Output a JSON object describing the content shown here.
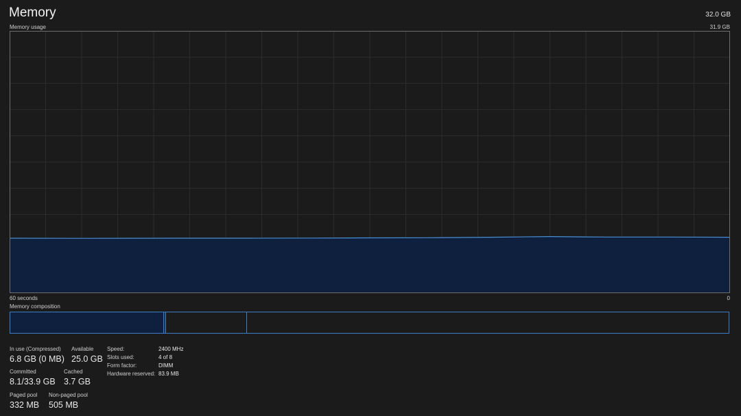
{
  "header": {
    "title": "Memory",
    "total": "32.0 GB"
  },
  "graph": {
    "label": "Memory usage",
    "max_label": "31.9 GB",
    "time_left_label": "60 seconds",
    "time_right_label": "0",
    "line_color": "#4a8fd4",
    "fill_color": "#0f1f3e",
    "grid_color": "#2c2c2c",
    "border_color": "#6e6e6e"
  },
  "composition": {
    "label": "Memory composition",
    "border_color": "#3d7ec4"
  },
  "stats": {
    "in_use": {
      "label": "In use (Compressed)",
      "value": "6.8 GB (0 MB)"
    },
    "available": {
      "label": "Available",
      "value": "25.0 GB"
    },
    "committed": {
      "label": "Committed",
      "value": "8.1/33.9 GB"
    },
    "cached": {
      "label": "Cached",
      "value": "3.7 GB"
    },
    "paged_pool": {
      "label": "Paged pool",
      "value": "332 MB"
    },
    "non_paged_pool": {
      "label": "Non-paged pool",
      "value": "505 MB"
    }
  },
  "hardware": {
    "speed": {
      "label": "Speed:",
      "value": "2400 MHz"
    },
    "slots": {
      "label": "Slots used:",
      "value": "4 of 8"
    },
    "form_factor": {
      "label": "Form factor:",
      "value": "DIMM"
    },
    "reserved": {
      "label": "Hardware reserved:",
      "value": "83.9 MB"
    }
  },
  "chart_data": {
    "type": "area",
    "x": [
      60,
      55,
      50,
      45,
      40,
      35,
      30,
      25,
      20,
      15,
      12,
      10,
      5,
      0
    ],
    "series": [
      {
        "values": [
          6.68,
          6.66,
          6.67,
          6.68,
          6.68,
          6.7,
          6.72,
          6.74,
          6.8,
          6.88,
          6.84,
          6.82,
          6.82,
          6.8
        ]
      }
    ],
    "xlim": [
      60,
      0
    ],
    "ylim": [
      0,
      31.9
    ],
    "grid": true
  }
}
